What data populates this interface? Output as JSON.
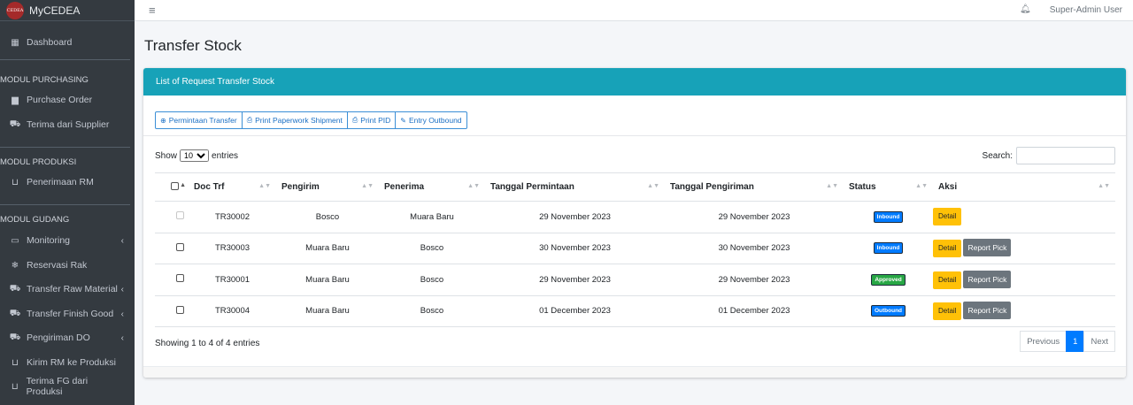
{
  "brand": {
    "logo_text": "CEDEA",
    "name": "MyCEDEA"
  },
  "sidebar": {
    "dashboard": "Dashboard",
    "headers": [
      "MODUL PURCHASING",
      "MODUL PRODUKSI",
      "MODUL GUDANG"
    ],
    "purchasing": [
      "Purchase Order",
      "Terima dari Supplier"
    ],
    "produksi": [
      "Penerimaan RM"
    ],
    "gudang": [
      "Monitoring",
      "Reservasi Rak",
      "Transfer Raw Material",
      "Transfer Finish Good",
      "Pengiriman DO",
      "Kirim RM ke Produksi",
      "Terima FG dari Produksi"
    ]
  },
  "topbar": {
    "user": "Super-Admin User"
  },
  "page": {
    "title": "Transfer Stock"
  },
  "card": {
    "header": "List of Request Transfer Stock",
    "toolbar": [
      "Permintaan Transfer",
      "Print Paperwork Shipment",
      "Print PID",
      "Entry Outbound"
    ],
    "show_label": "Show",
    "show_value": "10",
    "entries_label": "entries",
    "search_label": "Search:",
    "search_value": "",
    "columns": [
      "Doc Trf",
      "Pengirim",
      "Penerima",
      "Tanggal Permintaan",
      "Tanggal Pengiriman",
      "Status",
      "Aksi"
    ],
    "rows": [
      {
        "doc": "TR30002",
        "from": "Bosco",
        "to": "Muara Baru",
        "req": "29 November 2023",
        "ship": "29 November 2023",
        "status": "Inbound",
        "detail": "Detail"
      },
      {
        "doc": "TR30003",
        "from": "Muara Baru",
        "to": "Bosco",
        "req": "30 November 2023",
        "ship": "30 November 2023",
        "status": "Inbound",
        "detail": "Detail",
        "report": "Report Pick"
      },
      {
        "doc": "TR30001",
        "from": "Muara Baru",
        "to": "Bosco",
        "req": "29 November 2023",
        "ship": "29 November 2023",
        "status": "Approved",
        "detail": "Detail",
        "report": "Report Pick"
      },
      {
        "doc": "TR30004",
        "from": "Muara Baru",
        "to": "Bosco",
        "req": "01 December 2023",
        "ship": "01 December 2023",
        "status": "Outbound",
        "detail": "Detail",
        "report": "Report Pick"
      }
    ],
    "info": "Showing 1 to 4 of 4 entries",
    "pager": {
      "prev": "Previous",
      "page": "1",
      "next": "Next"
    }
  },
  "colors": {
    "sidebar": "#343a40",
    "header": "#17a2b8",
    "primary": "#007bff",
    "warning": "#ffc107",
    "success": "#28a745",
    "secondary": "#6c757d"
  }
}
